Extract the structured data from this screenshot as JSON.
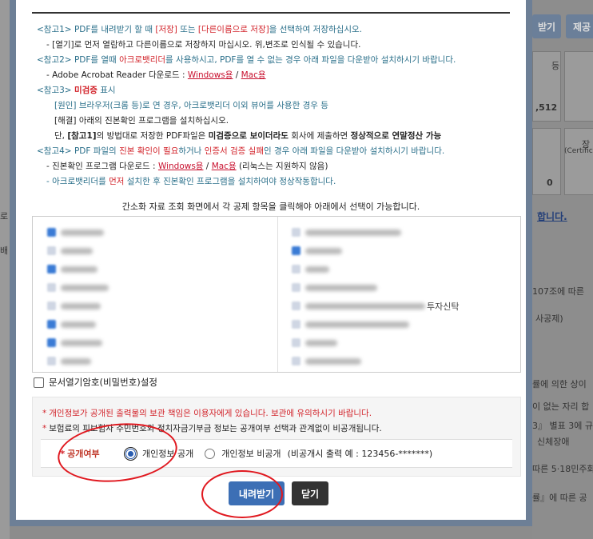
{
  "background": {
    "right_btn_1": "받기",
    "right_btn_2": "제공",
    "r_text_1": "등",
    "r_text_2": ",512",
    "r_text_3": "장",
    "r_text_4": "(Certific",
    "r_text_5": "0",
    "r_text_6": "합니다.",
    "r_text_7": "107조에 따른",
    "r_text_8": "사공제)",
    "r_text_9": "률에 의한 상이",
    "r_text_10": "이 없는 자리 합",
    "r_text_11": "3』 별표 3에 규",
    "r_text_12": "신체장애",
    "r_text_13": "따른 5·18민주화",
    "r_text_14": "률』에 따른 공",
    "left_text_1": "로",
    "left_text_2": "배"
  },
  "notes": {
    "n1_tag": "<참고1>",
    "n1_a": " PDF를 내려받기 할 때 ",
    "n1_save": "[저장]",
    "n1_b": " 또는 ",
    "n1_saveas": "[다른이름으로 저장]",
    "n1_c": "을 선택하여 저장하십시오.",
    "n1_sub": "- [열기]로 먼저 열람하고 다른이름으로 저장하지 마십시오. 위,변조로 인식될 수 있습니다.",
    "n2_tag": "<참고2>",
    "n2_a": " PDF를 열때 ",
    "n2_acro": "아크로뱃리더",
    "n2_b": "를 사용하시고, PDF를 열 수 없는 경우 아래 파일을 다운받아 설치하시기 바랍니다.",
    "n2_sub": "- Adobe Acrobat Reader 다운로드 : ",
    "n2_win": "Windows용",
    "n2_sep": " / ",
    "n2_mac": "Mac용",
    "n3_tag": "<참고3>",
    "n3_unverified": "미검증",
    "n3_a": " 표시",
    "n3_cause": "[원인] 브라우저(크롬 등)로 연 경우, 아크로뱃리더 이외 뷰어를 사용한 경우 등",
    "n3_fix": "[해결] 아래의 진본확인 프로그램을 설치하십시오.",
    "n3_d1": "단, ",
    "n3_ref": "[참고1]",
    "n3_d2": "의 방법대로 저장한 PDF파일은 ",
    "n3_d3": "미검증으로 보이더라도",
    "n3_d4": " 회사에 제출하면 ",
    "n3_d5": "정상적으로 연말정산 가능",
    "n4_tag": "<참고4>",
    "n4_a": " PDF 파일의 ",
    "n4_b": "진본 확인이 필요",
    "n4_c": "하거나 ",
    "n4_d": "인증서 검증 실패",
    "n4_e": "인 경우 아래 파일을 다운받아 설치하시기 바랍니다.",
    "n4_sub": "- 진본확인 프로그램 다운로드 : ",
    "n4_win": "Windows용",
    "n4_sep": " / ",
    "n4_mac": "Mac용",
    "n4_note": " (리눅스는 지원하지 않음)",
    "n4_sub2a": "- 아크로뱃리더를 ",
    "n4_first": "먼저",
    "n4_sub2b": " 설치한 후 진본확인 프로그램을 설치하여야 정상작동합니다."
  },
  "caption": "간소화 자료 조회 화면에서 각 공제 항목을 클릭해야 아래에서 선택이 가능합니다.",
  "deduction_list": {
    "visible_suffix": "투자신탁"
  },
  "encrypt_option": {
    "label": "문서열기암호(비밀번호)설정"
  },
  "privacy": {
    "warn_a": "개인정보가 공개된 출력물의 보관 책임은 이용자에게 있습니다. 보관에 유의하시기 바랍니다.",
    "warn_b": "보험료의 피보험자 주민번호와 정치자금기부금 정보는 공개여부 선택과 관계없이 비공개됩니다.",
    "disclose_label": "공개여부",
    "opt_public": "개인정보 공개",
    "opt_private": "개인정보 비공개",
    "private_example": "(비공개시 출력 예 : 123456-*******)"
  },
  "buttons": {
    "download": "내려받기",
    "close": "닫기"
  },
  "colors": {
    "accent": "#3c6fb5",
    "red": "#d2232a",
    "teal": "#2a6f8a",
    "annotation": "#e0181f"
  }
}
